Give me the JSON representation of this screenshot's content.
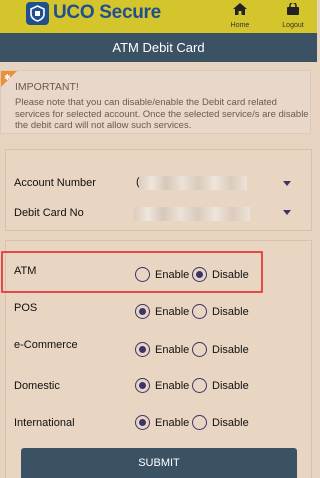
{
  "header": {
    "logo_text": "UCO Secure",
    "nav": [
      {
        "label": "Home",
        "icon": "home-icon"
      },
      {
        "label": "Logout",
        "icon": "logout-icon"
      }
    ],
    "bg_color": "#d5c52c"
  },
  "title": "ATM Debit Card",
  "notice": {
    "title": "IMPORTANT!",
    "body": "Please note that you can disable/enable the  Debit card related services for selected account. Once the selected service/s are disable the debit card will not allow such services."
  },
  "account": {
    "account_number_label": "Account Number",
    "account_number_value": "(",
    "debit_card_label": "Debit Card No"
  },
  "options": [
    {
      "label": "ATM",
      "selected": "Disable"
    },
    {
      "label": "POS",
      "selected": "Enable"
    },
    {
      "label": "e-Commerce",
      "selected": "Enable"
    },
    {
      "label": "Domestic",
      "selected": "Enable"
    },
    {
      "label": "International",
      "selected": "Enable"
    }
  ],
  "radio_labels": {
    "enable": "Enable",
    "disable": "Disable"
  },
  "submit_label": "SUBMIT",
  "colors": {
    "primary": "#3b5265",
    "radio": "#3d3468",
    "highlight": "#e8464a",
    "background": "#e7d4c0"
  }
}
